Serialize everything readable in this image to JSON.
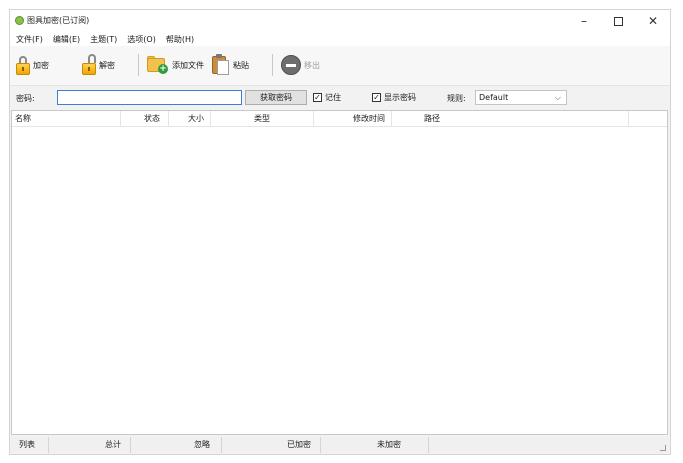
{
  "title": "图具加密(已订阅)",
  "window_controls": {
    "minimize": "–",
    "close": "✕"
  },
  "menu": [
    "文件(F)",
    "编辑(E)",
    "主题(T)",
    "选项(O)",
    "帮助(H)"
  ],
  "toolbar": {
    "encrypt": "加密",
    "decrypt": "解密",
    "add_file": "添加文件",
    "paste": "粘贴",
    "remove": "移出"
  },
  "password": {
    "label": "密码:",
    "value": "",
    "fetch_button": "获取密码",
    "remember_label": "记住",
    "remember_checked": true,
    "show_label": "显示密码",
    "show_checked": true,
    "rule_label": "规则:",
    "rule_value": "Default"
  },
  "columns": [
    "名称",
    "状态",
    "大小",
    "类型",
    "修改时间",
    "路径"
  ],
  "rows": [],
  "status": {
    "list": "列表",
    "total": "总计",
    "ignored": "忽略",
    "encrypted": "已加密",
    "unencrypted": "未加密"
  },
  "icons": [
    "app-icon",
    "lock-icon",
    "unlock-icon",
    "add-folder-icon",
    "clipboard-icon",
    "remove-icon",
    "chevron-down-icon",
    "checkmark-icon",
    "resize-grip-icon"
  ],
  "colors": {
    "accent": "#3c7fd0",
    "lock": "#f0a500",
    "add": "#2e9e3a"
  }
}
